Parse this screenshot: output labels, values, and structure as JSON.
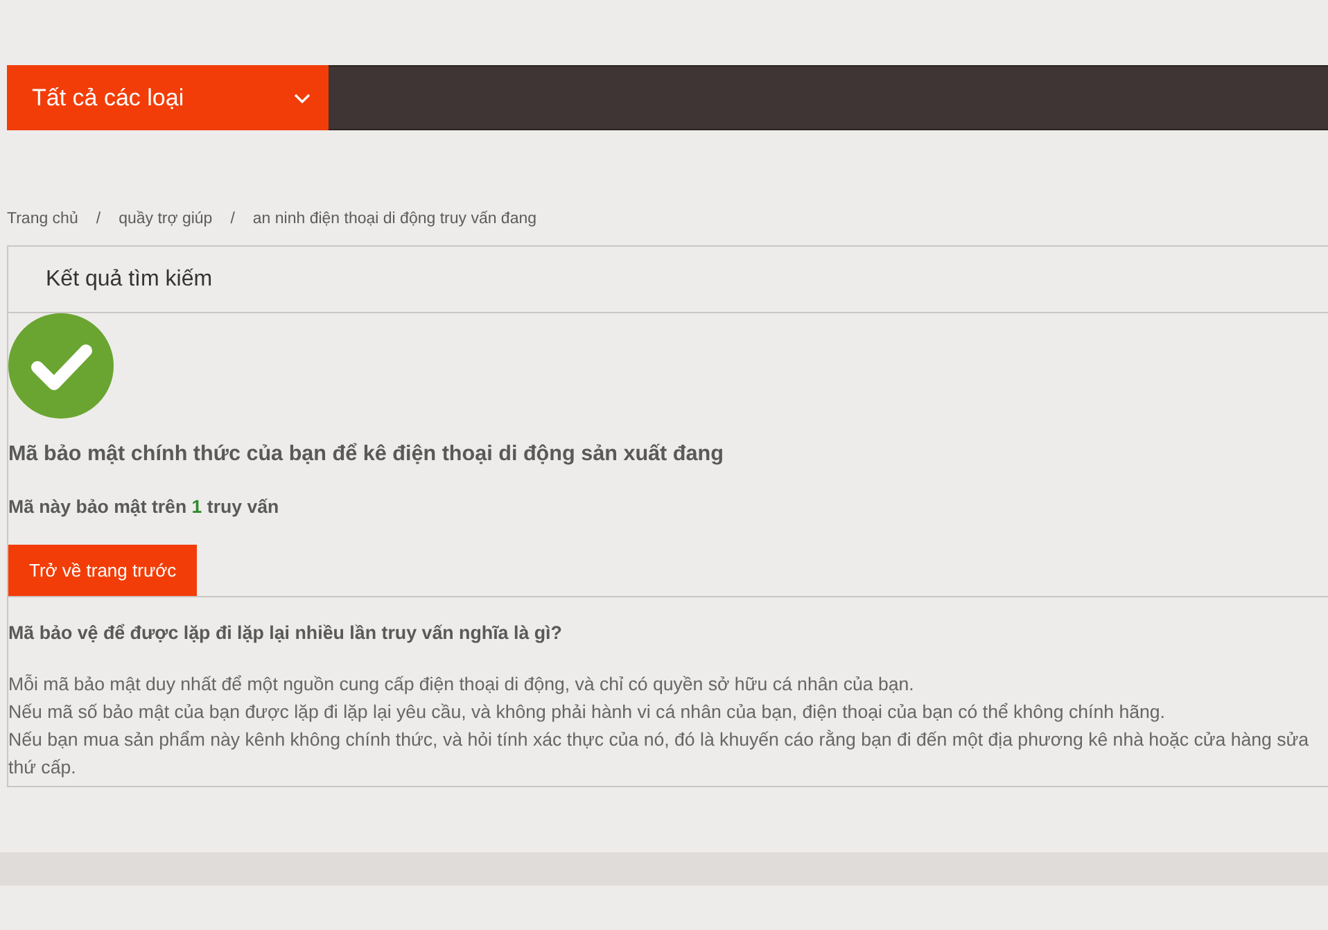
{
  "nav": {
    "category_menu": {
      "label": "Tất cả các loại"
    }
  },
  "breadcrumb": [
    {
      "label": "Trang chủ"
    },
    {
      "separator": "/",
      "label": "quầy trợ giúp"
    },
    {
      "separator": "/",
      "label": "an ninh điện thoại di động truy vấn đang"
    }
  ],
  "result_panel": {
    "title": "Kết quả tìm kiếm",
    "headline": "Mã bảo mật chính thức của bạn để kê điện thoại di động sản xuất đang",
    "query_count": {
      "before": "Mã này bảo mật trên",
      "count": "1",
      "after": "truy vấn"
    },
    "back_button": "Trở về trang trước"
  },
  "faq": {
    "question": "Mã bảo vệ để được lặp đi lặp lại nhiều lần truy vấn nghĩa là gì?",
    "lines": [
      "Mỗi mã bảo mật duy nhất để một nguồn cung cấp điện thoại di động, và chỉ có quyền sở hữu cá nhân của bạn.",
      "Nếu mã số bảo mật của bạn được lặp đi lặp lại yêu cầu, và không phải hành vi cá nhân của bạn, điện thoại của bạn có thể không chính hãng.",
      "Nếu bạn mua sản phẩm này kênh không chính thức, và hỏi tính xác thực của nó, đó là khuyến cáo rằng bạn đi đến một địa phương kê nhà hoặc cửa hàng sửa",
      "thứ cấp."
    ]
  }
}
